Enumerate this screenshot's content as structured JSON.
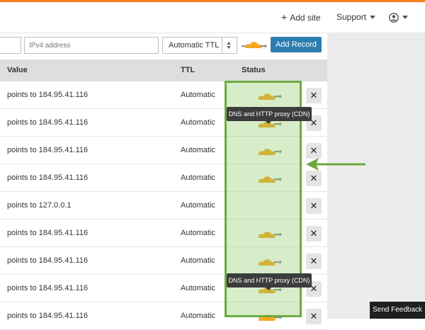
{
  "nav": {
    "add_site_label": "Add site",
    "support_label": "Support"
  },
  "form": {
    "ipv4_placeholder": "IPv4 address",
    "ttl_selected": "Automatic TTL",
    "add_record_label": "Add Record"
  },
  "table": {
    "columns": {
      "value": "Value",
      "ttl": "TTL",
      "status": "Status"
    },
    "rows": [
      {
        "value": "points to 184.95.41.116",
        "ttl": "Automatic",
        "proxied": true
      },
      {
        "value": "points to 184.95.41.116",
        "ttl": "Automatic",
        "proxied": true
      },
      {
        "value": "points to 184.95.41.116",
        "ttl": "Automatic",
        "proxied": true
      },
      {
        "value": "points to 184.95.41.116",
        "ttl": "Automatic",
        "proxied": true
      },
      {
        "value": "points to 127.0.0.1",
        "ttl": "Automatic",
        "proxied": false
      },
      {
        "value": "points to 184.95.41.116",
        "ttl": "Automatic",
        "proxied": true
      },
      {
        "value": "points to 184.95.41.116",
        "ttl": "Automatic",
        "proxied": true
      },
      {
        "value": "points to 184.95.41.116",
        "ttl": "Automatic",
        "proxied": true
      },
      {
        "value": "points to 184.95.41.116",
        "ttl": "Automatic",
        "proxied": true
      }
    ],
    "delete_label": "✕"
  },
  "tooltip": {
    "text": "DNS and HTTP proxy (CDN)"
  },
  "feedback": {
    "label": "Send Feedback"
  },
  "colors": {
    "accent": "#f38020",
    "button_blue": "#2c7cb0",
    "highlight_green": "#6aab3f",
    "cloud_orange": "#f6a821",
    "arrow_gray": "#8c8c8c"
  },
  "icons": {
    "cloud": "proxy-cloud-icon",
    "user": "user-circle-icon",
    "delete": "close-icon",
    "arrow": "arrow-left-icon"
  }
}
